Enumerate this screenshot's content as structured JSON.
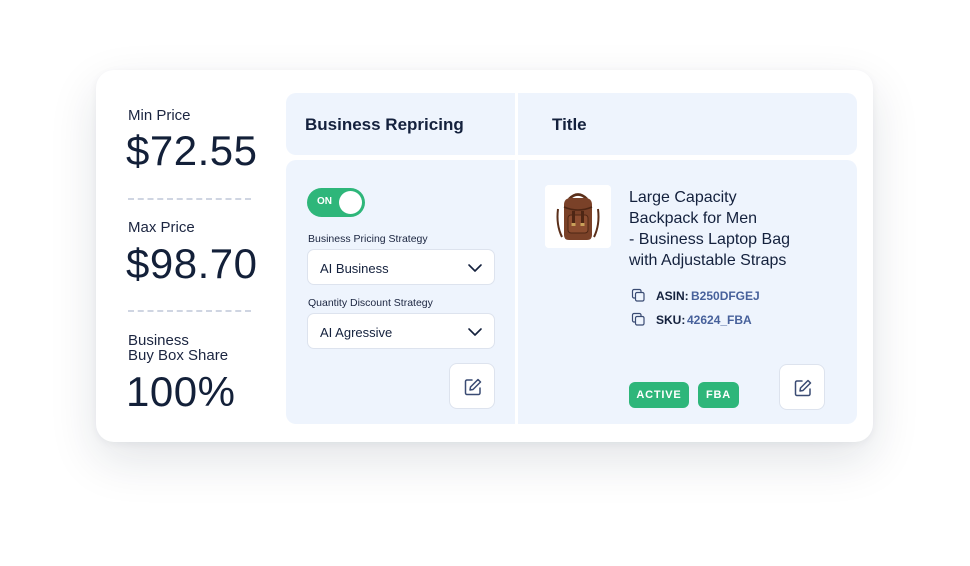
{
  "stats": {
    "min_price": {
      "label": "Min Price",
      "value": "$72.55"
    },
    "max_price": {
      "label": "Max Price",
      "value": "$98.70"
    },
    "buy_box": {
      "label_line1": "Business",
      "label_line2": "Buy Box Share",
      "value": "100%"
    }
  },
  "table": {
    "headers": {
      "business_repricing": "Business Repricing",
      "title": "Title"
    }
  },
  "repricing": {
    "toggle_label": "ON",
    "toggle_on": true,
    "pricing_strategy": {
      "label": "Business Pricing Strategy",
      "value": "AI Business"
    },
    "discount_strategy": {
      "label": "Quantity Discount Strategy",
      "value": "AI Agressive"
    }
  },
  "product": {
    "title_lines": [
      "Large Capacity",
      "Backpack for Men",
      "- Business Laptop Bag",
      "with Adjustable Straps"
    ],
    "asin": {
      "label": "ASIN:",
      "value": "B250DFGEJ"
    },
    "sku": {
      "label": "SKU:",
      "value": "42624_FBA"
    },
    "badges": [
      "ACTIVE",
      "FBA"
    ]
  },
  "icons": {
    "copy": "copy-icon",
    "edit": "edit-icon",
    "chevron": "chevron-down-icon"
  },
  "colors": {
    "accent_green": "#2eb67a",
    "panel_bg": "#eef4fd",
    "link_blue": "#47619b",
    "text_dark": "#14213d"
  }
}
